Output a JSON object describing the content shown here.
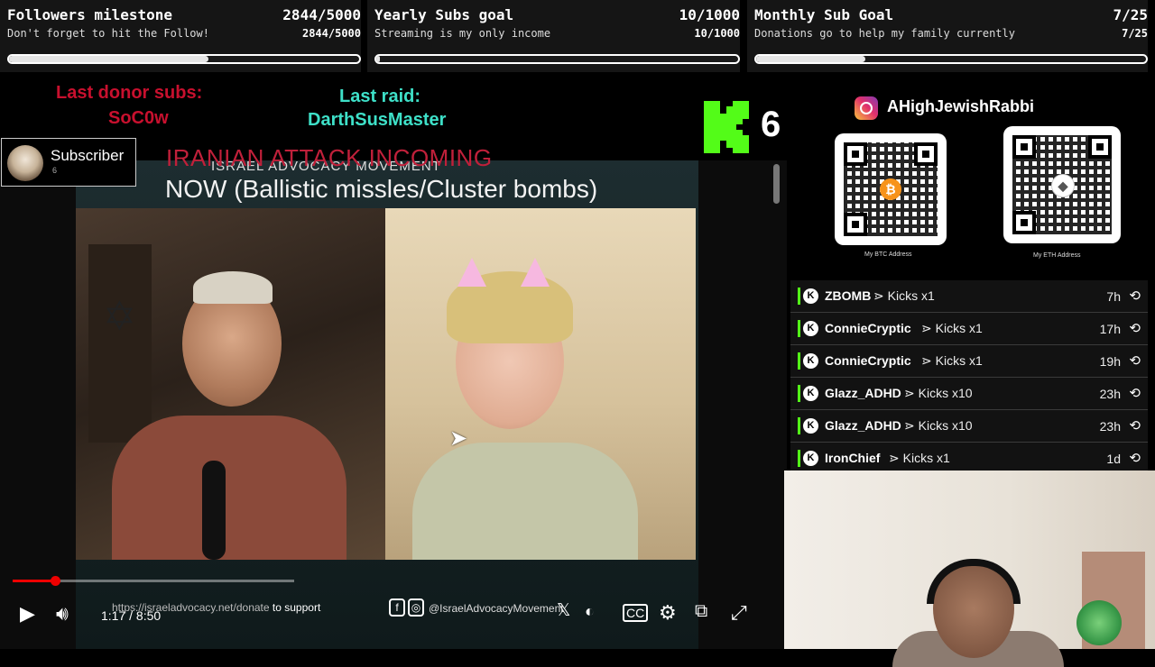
{
  "goals": [
    {
      "title": "Followers milestone",
      "count": "2844/5000",
      "subtitle": "Don't forget to hit the Follow!",
      "progress": 0.5688
    },
    {
      "title": "Yearly Subs goal",
      "count": "10/1000",
      "subtitle": "Streaming is my only income",
      "progress": 0.01
    },
    {
      "title": "Monthly Sub Goal",
      "count": "7/25",
      "subtitle": "Donations go to help my family currently",
      "progress": 0.28
    }
  ],
  "last_donor": {
    "label": "Last donor subs:",
    "name": "SoC0w"
  },
  "last_raid": {
    "label": "Last raid:",
    "name": "DarthSusMaster"
  },
  "kick": {
    "count": "6",
    "brand_color": "#53fc18"
  },
  "subscriber_card": {
    "label": "Subscriber",
    "count": "6"
  },
  "alert": {
    "headline": "IRANIAN ATTACK INCOMING",
    "detail": "NOW (Ballistic missles/Cluster bombs)"
  },
  "video": {
    "overlay_title": "ISRAEL ADVOCACY MOVEMENT",
    "time": "1:17 / 8:50",
    "progress": 0.15,
    "donate_url": "https://israeladvocacy.net/donate",
    "donate_suffix": "to support",
    "social_handle": "@IsraelAdvocacyMovement"
  },
  "instagram": {
    "handle": "AHighJewishRabbi"
  },
  "qr_codes": [
    {
      "caption": "My BTC Address",
      "coin": "btc"
    },
    {
      "caption": "My ETH Address",
      "coin": "eth"
    }
  ],
  "events": [
    {
      "user": "ZBOMB",
      "action": "⋗ Kicks x1",
      "time": "7h"
    },
    {
      "user": "ConnieCryptic",
      "action": "⋗ Kicks x1",
      "time": "17h"
    },
    {
      "user": "ConnieCryptic",
      "action": "⋗ Kicks x1",
      "time": "19h"
    },
    {
      "user": "Glazz_ADHD",
      "action": "⋗ Kicks x10",
      "time": "23h"
    },
    {
      "user": "Glazz_ADHD",
      "action": "⋗ Kicks x10",
      "time": "23h"
    },
    {
      "user": "IronChief",
      "action": "⋗ Kicks x1",
      "time": "1d"
    }
  ]
}
